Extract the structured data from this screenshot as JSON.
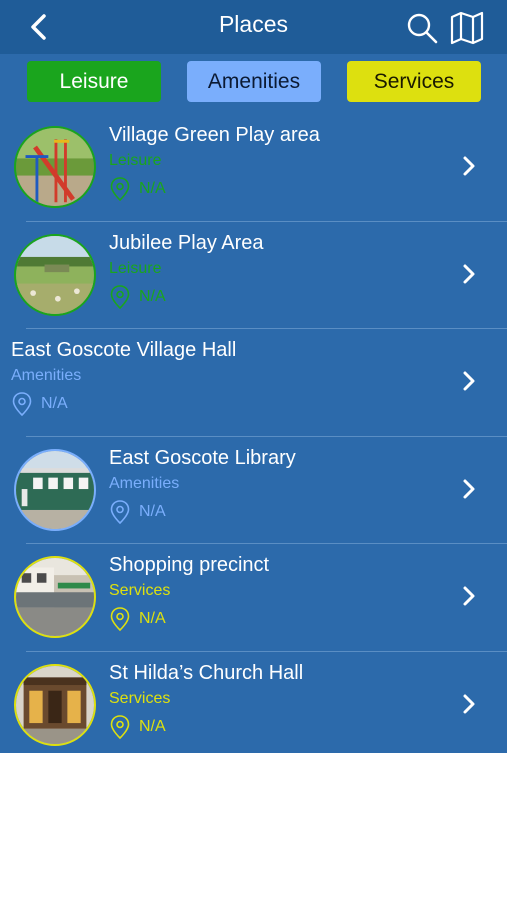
{
  "header": {
    "title": "Places",
    "back_icon": "back-chevron-icon",
    "search_icon": "search-icon",
    "map_icon": "map-icon"
  },
  "filters": [
    {
      "label": "Leisure",
      "color": "#1aa51d"
    },
    {
      "label": "Amenities",
      "color": "#7aaefc"
    },
    {
      "label": "Services",
      "color": "#dde00f"
    }
  ],
  "places": [
    {
      "name": "Village Green Play area",
      "category": "Leisure",
      "distance": "N/A"
    },
    {
      "name": "Jubilee  Play Area",
      "category": "Leisure",
      "distance": "N/A"
    },
    {
      "name": "East Goscote Village Hall",
      "category": "Amenities",
      "distance": "N/A"
    },
    {
      "name": "East Goscote Library",
      "category": "Amenities",
      "distance": "N/A"
    },
    {
      "name": "Shopping precinct",
      "category": "Services",
      "distance": "N/A"
    },
    {
      "name": "St Hilda’s Church Hall",
      "category": "Services",
      "distance": "N/A"
    }
  ],
  "colors": {
    "header_bg": "#1f5c98",
    "list_bg": "#2c6aab",
    "leisure": "#1aa51d",
    "amenities": "#7aaefc",
    "services": "#dde00f"
  }
}
